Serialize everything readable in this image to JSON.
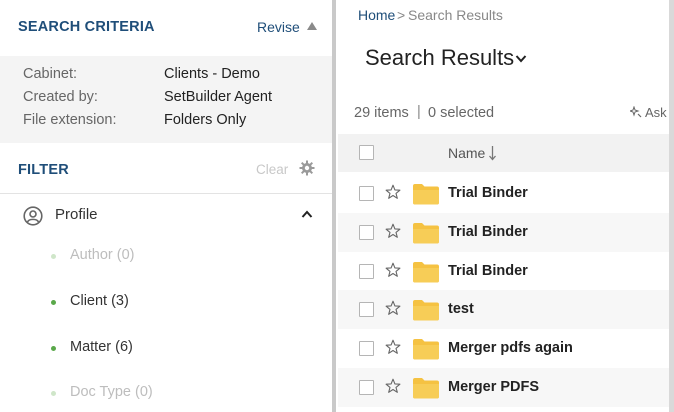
{
  "criteria": {
    "title": "SEARCH CRITERIA",
    "revise_label": "Revise",
    "rows": [
      {
        "label": "Cabinet:",
        "value": "Clients - Demo"
      },
      {
        "label": "Created by:",
        "value": "SetBuilder Agent"
      },
      {
        "label": "File extension:",
        "value": "Folders Only"
      }
    ]
  },
  "filter": {
    "title": "FILTER",
    "clear_label": "Clear",
    "group_label": "Profile",
    "facets": [
      {
        "label": "Author (0)",
        "active": false
      },
      {
        "label": "Client (3)",
        "active": true
      },
      {
        "label": "Matter (6)",
        "active": true
      },
      {
        "label": "Doc Type (0)",
        "active": false
      }
    ]
  },
  "breadcrumb": {
    "home": "Home",
    "separator": ">",
    "current": "Search Results"
  },
  "results": {
    "title": "Search Results",
    "count_text": "29 items",
    "count_separator": "|",
    "selected_text": "0 selected",
    "ask_label": "Ask",
    "column_name": "Name",
    "rows": [
      {
        "name": "Trial Binder"
      },
      {
        "name": "Trial Binder"
      },
      {
        "name": "Trial Binder"
      },
      {
        "name": "test"
      },
      {
        "name": "Merger pdfs again"
      },
      {
        "name": "Merger PDFS"
      }
    ]
  },
  "icons": {
    "collapse": "triangle-up-icon",
    "gear": "gear-icon",
    "profile": "user-circle-icon",
    "group_toggle": "chevron-up-icon",
    "title_menu": "chevron-down-icon",
    "sort": "sort-descending-icon",
    "ask": "sparkle-icon",
    "favorite": "star-icon",
    "folder": "folder-icon"
  },
  "colors": {
    "accent": "#1f4e79",
    "facet_active": "#5aa84a",
    "folder": "#f5c242",
    "muted": "#bdbdbd"
  }
}
